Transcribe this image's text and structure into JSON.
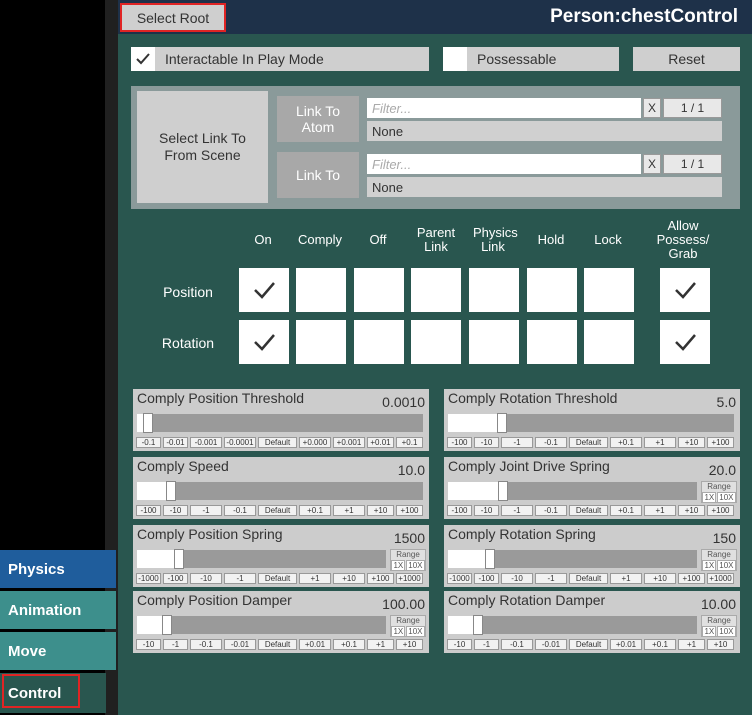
{
  "header": {
    "select_root": "Select Root",
    "title": "Person:chestControl"
  },
  "top_row": {
    "interactable_label": "Interactable In Play Mode",
    "interactable_checked": true,
    "possessable_label": "Possessable",
    "possessable_checked": false,
    "reset_label": "Reset"
  },
  "link": {
    "select_label": "Select Link To From Scene",
    "atom_label": "Link To Atom",
    "atom_filter_placeholder": "Filter...",
    "atom_clear": "X",
    "atom_count": "1 / 1",
    "atom_value": "None",
    "to_label": "Link To",
    "to_filter_placeholder": "Filter...",
    "to_clear": "X",
    "to_count": "1 / 1",
    "to_value": "None"
  },
  "grid": {
    "headers": [
      "On",
      "Comply",
      "Off",
      "Parent Link",
      "Physics Link",
      "Hold",
      "Lock"
    ],
    "allow_header": "Allow Possess/ Grab",
    "rows": [
      {
        "label": "Position",
        "checked": [
          true,
          false,
          false,
          false,
          false,
          false,
          false
        ],
        "allow": true
      },
      {
        "label": "Rotation",
        "checked": [
          true,
          false,
          false,
          false,
          false,
          false,
          false
        ],
        "allow": true
      }
    ]
  },
  "sliders": [
    {
      "title": "Comply Position Threshold",
      "value": "0.0010",
      "fill": 0.02,
      "range": false,
      "buttons": [
        "-0.1",
        "-0.01",
        "-0.001",
        "-0.0001",
        "Default",
        "+0.000",
        "+0.001",
        "+0.01",
        "+0.1"
      ]
    },
    {
      "title": "Comply Rotation Threshold",
      "value": "5.0",
      "fill": 0.17,
      "range": false,
      "buttons": [
        "-100",
        "-10",
        "-1",
        "-0.1",
        "Default",
        "+0.1",
        "+1",
        "+10",
        "+100"
      ]
    },
    {
      "title": "Comply Speed",
      "value": "10.0",
      "fill": 0.1,
      "range": false,
      "buttons": [
        "-100",
        "-10",
        "-1",
        "-0.1",
        "Default",
        "+0.1",
        "+1",
        "+10",
        "+100"
      ]
    },
    {
      "title": "Comply Joint Drive Spring",
      "value": "20.0",
      "fill": 0.2,
      "range": true,
      "range_label": "Range",
      "range_1x": "1X",
      "range_10x": "10X",
      "buttons": [
        "-100",
        "-10",
        "-1",
        "-0.1",
        "Default",
        "+0.1",
        "+1",
        "+10",
        "+100"
      ]
    },
    {
      "title": "Comply Position Spring",
      "value": "1500",
      "fill": 0.15,
      "range": true,
      "range_label": "Range",
      "range_1x": "1X",
      "range_10x": "10X",
      "buttons": [
        "-1000",
        "-100",
        "-10",
        "-1",
        "Default",
        "+1",
        "+10",
        "+100",
        "+1000"
      ]
    },
    {
      "title": "Comply Rotation Spring",
      "value": "150",
      "fill": 0.15,
      "range": true,
      "range_label": "Range",
      "range_1x": "1X",
      "range_10x": "10X",
      "buttons": [
        "-1000",
        "-100",
        "-10",
        "-1",
        "Default",
        "+1",
        "+10",
        "+100",
        "+1000"
      ]
    },
    {
      "title": "Comply Position Damper",
      "value": "100.00",
      "fill": 0.1,
      "range": true,
      "range_label": "Range",
      "range_1x": "1X",
      "range_10x": "10X",
      "buttons": [
        "-10",
        "-1",
        "-0.1",
        "-0.01",
        "Default",
        "+0.01",
        "+0.1",
        "+1",
        "+10"
      ]
    },
    {
      "title": "Comply Rotation Damper",
      "value": "10.00",
      "fill": 0.1,
      "range": true,
      "range_label": "Range",
      "range_1x": "1X",
      "range_10x": "10X",
      "buttons": [
        "-10",
        "-1",
        "-0.1",
        "-0.01",
        "Default",
        "+0.01",
        "+0.1",
        "+1",
        "+10"
      ]
    }
  ],
  "tabs": [
    {
      "label": "Physics",
      "color": "#1f5d9c"
    },
    {
      "label": "Animation",
      "color": "#3d8f8c"
    },
    {
      "label": "Move",
      "color": "#3d8f8c"
    },
    {
      "label": "Control",
      "color": "#29564f",
      "selected": true
    }
  ],
  "colors": {
    "panel": "#29564f",
    "header": "#1e3149",
    "highlight": "#e02424"
  }
}
